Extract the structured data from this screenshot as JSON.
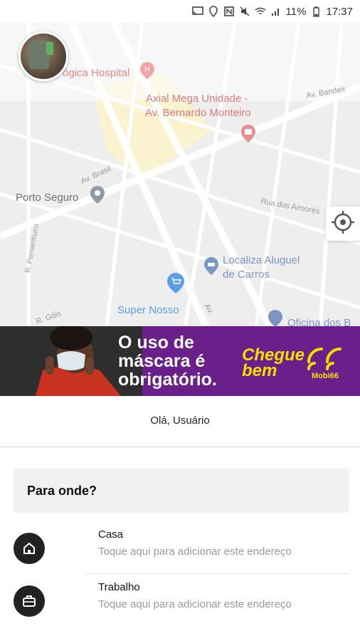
{
  "status": {
    "battery": "11%",
    "time": "17:37"
  },
  "map": {
    "labels": {
      "hospital": "ógica Hospital",
      "mega_unidade_1": "Axial Mega Unidade -",
      "mega_unidade_2": "Av. Bernardo Monteiro",
      "av_brasil": "Av. Brasil",
      "porto_seguro": "Porto Seguro",
      "rua_aimores": "Rua dos Aimorés",
      "av_bandeir": "Av. Bandeir",
      "localiza_1": "Localiza Aluguel",
      "localiza_2": "de Carros",
      "super_nosso": "Super Nosso",
      "oficina": "Oficina dos B",
      "r_pernambuco": "R. Pernambuco",
      "r_gois": "R. Góis",
      "av": "Av."
    }
  },
  "banner": {
    "headline": "O uso de máscara é obrigatório.",
    "brand_word": "Chegue bem",
    "brand_small": "Mobi66",
    "colors": {
      "purple": "#6a1f8a",
      "yellow": "#f0e100"
    }
  },
  "greeting": "Olá, Usuário",
  "search": {
    "label": "Para onde?"
  },
  "shortcuts": [
    {
      "icon": "home-icon",
      "title": "Casa",
      "subtitle": "Toque aqui para adicionar este endereço"
    },
    {
      "icon": "briefcase-icon",
      "title": "Trabalho",
      "subtitle": "Toque aqui para adicionar este endereço"
    }
  ]
}
